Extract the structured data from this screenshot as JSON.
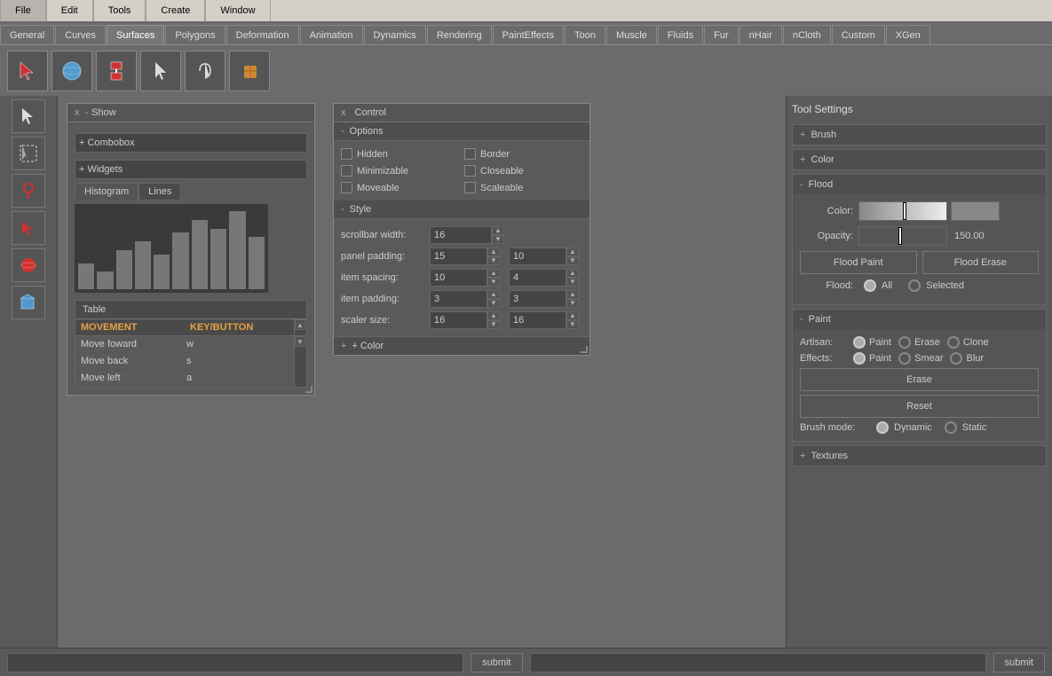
{
  "menu": {
    "items": [
      "File",
      "Edit",
      "Tools",
      "Create",
      "Window"
    ]
  },
  "tabs": {
    "items": [
      "General",
      "Curves",
      "Surfaces",
      "Polygons",
      "Deformation",
      "Animation",
      "Dynamics",
      "Rendering",
      "PaintEffects",
      "Toon",
      "Muscle",
      "Fluids",
      "Fur",
      "nHair",
      "nCloth",
      "Custom",
      "XGen"
    ],
    "active": "Surfaces"
  },
  "toolbar": {
    "buttons": [
      "arrow-tool",
      "sphere-tool",
      "rig-tool",
      "select-tool",
      "lasso-tool",
      "paint-tool"
    ]
  },
  "left_sidebar": {
    "tools": [
      "select",
      "lasso",
      "brush",
      "arrow-down",
      "paint-ball",
      "cube-rig"
    ]
  },
  "show_panel": {
    "title": "Show",
    "combobox_label": "+  Combobox",
    "widgets_label": "+  Widgets",
    "tabs": [
      "Histogram",
      "Lines"
    ],
    "active_tab": "Histogram",
    "histogram_bars": [
      30,
      20,
      45,
      55,
      40,
      65,
      80,
      70,
      90,
      60
    ],
    "table_title": "Table",
    "table_headers": [
      "MOVEMENT",
      "KEY/BUTTON"
    ],
    "table_rows": [
      {
        "movement": "Move foward",
        "key": "w"
      },
      {
        "movement": "Move back",
        "key": "s"
      },
      {
        "movement": "Move left",
        "key": "a"
      }
    ]
  },
  "control_panel": {
    "title": "Control",
    "options": {
      "title": "Options",
      "items": [
        {
          "label": "Hidden",
          "checked": false
        },
        {
          "label": "Border",
          "checked": false
        },
        {
          "label": "Minimizable",
          "checked": false
        },
        {
          "label": "Closeable",
          "checked": false
        },
        {
          "label": "Moveable",
          "checked": false
        },
        {
          "label": "Scaleable",
          "checked": false
        }
      ]
    },
    "style": {
      "title": "Style",
      "fields": [
        {
          "label": "scrollbar width:",
          "val1": "16",
          "val2": null
        },
        {
          "label": "panel padding:",
          "val1": "15",
          "val2": "10"
        },
        {
          "label": "item spacing:",
          "val1": "10",
          "val2": "4"
        },
        {
          "label": "item padding:",
          "val1": "3",
          "val2": "3"
        },
        {
          "label": "scaler size:",
          "val1": "16",
          "val2": "16"
        }
      ]
    },
    "color_label": "+  Color"
  },
  "tool_settings": {
    "title": "Tool Settings",
    "brush_label": "Brush",
    "color_label": "Color",
    "flood": {
      "title": "Flood",
      "color_label": "Color:",
      "opacity_label": "Opacity:",
      "opacity_value": "150.00",
      "flood_paint_label": "Flood Paint",
      "flood_erase_label": "Flood Erase",
      "flood_label": "Flood:",
      "radio_all": "All",
      "radio_selected": "Selected"
    },
    "paint": {
      "title": "Paint",
      "artisan_label": "Artisan:",
      "artisan_options": [
        "Paint",
        "Erase",
        "Clone"
      ],
      "effects_label": "Effects:",
      "effects_options": [
        "Paint",
        "Smear",
        "Blur"
      ],
      "erase_btn": "Erase",
      "reset_btn": "Reset",
      "brush_mode_label": "Brush mode:",
      "brush_mode_options": [
        "Dynamic",
        "Static"
      ]
    },
    "textures": {
      "title": "Textures"
    }
  },
  "bottom_bar": {
    "left_input_placeholder": "",
    "left_btn_label": "submit",
    "right_input_placeholder": "",
    "right_btn_label": "submit"
  }
}
